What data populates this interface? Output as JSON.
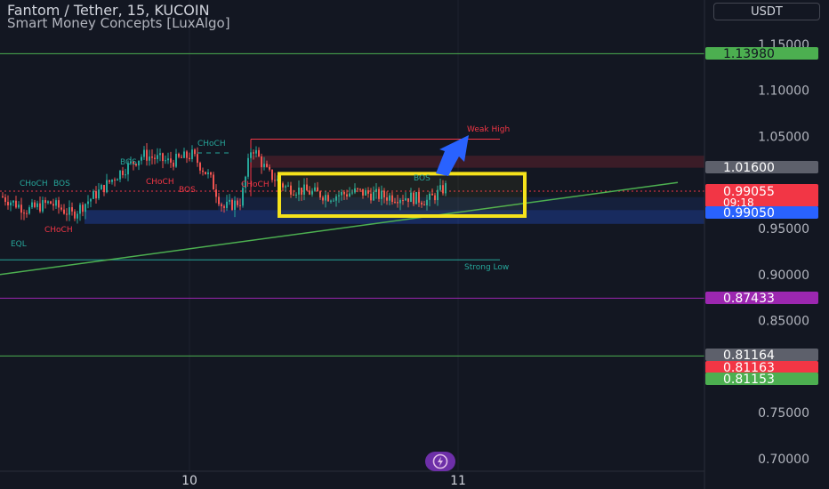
{
  "header": {
    "symbol": "Fantom / Tether, 15, KUCOIN",
    "indicator": "Smart Money Concepts [LuxAlgo]",
    "currency": "USDT"
  },
  "colors": {
    "background": "#131722",
    "grid": "#1e222d",
    "bull": "#26a69a",
    "bear": "#ef5350",
    "highlight": "#f5e21b",
    "arrow": "#2962ff",
    "green_line": "#4caf50"
  },
  "chart_data": {
    "type": "candlestick",
    "ylim": [
      0.69,
      1.165
    ],
    "y_ticks": [
      "0.70000",
      "0.75000",
      "0.85000",
      "0.90000",
      "0.95000",
      "1.05000",
      "1.10000",
      "1.15000"
    ],
    "x_ticks": [
      "10",
      "11"
    ],
    "price_labels": [
      {
        "value": 1.1398,
        "text": "1.13980",
        "color": "#4caf50",
        "text_color": "#131722"
      },
      {
        "value": 1.016,
        "text": "1.01600",
        "color": "#5d606b",
        "text_color": "#ffffff"
      },
      {
        "value": 0.99055,
        "text": "0.99055",
        "countdown": "09:18",
        "color": "#f23645",
        "text_color": "#ffffff"
      },
      {
        "value": 0.9905,
        "text": "0.99050",
        "color": "#2962ff",
        "text_color": "#ffffff"
      },
      {
        "value": 0.87433,
        "text": "0.87433",
        "color": "#9c27b0",
        "text_color": "#ffffff"
      },
      {
        "value": 0.81164,
        "text": "0.81164",
        "color": "#5d606b",
        "text_color": "#ffffff"
      },
      {
        "value": 0.81163,
        "text": "0.81163",
        "color": "#f23645",
        "text_color": "#ffffff"
      },
      {
        "value": 0.81153,
        "text": "0.81153",
        "color": "#4caf50",
        "text_color": "#ffffff"
      }
    ],
    "horizontal_lines": [
      {
        "value": 1.1398,
        "color": "#4caf50"
      },
      {
        "value": 0.87433,
        "color": "#9c27b0"
      },
      {
        "value": 0.81164,
        "color": "#4caf50"
      }
    ],
    "annotations": [
      {
        "text": "Weak High",
        "color": "#f23645"
      },
      {
        "text": "Strong Low",
        "color": "#26a69a"
      },
      {
        "text": "CHoCH",
        "color": "#26a69a"
      },
      {
        "text": "BOS",
        "color": "#26a69a"
      },
      {
        "text": "CHoCH",
        "color": "#f23645"
      },
      {
        "text": "BOS",
        "color": "#f23645"
      },
      {
        "text": "CHoCH",
        "color": "#f23645"
      },
      {
        "text": "BOS",
        "color": "#26a69a"
      },
      {
        "text": "CHoCH",
        "color": "#26a69a"
      },
      {
        "text": "CHoCH",
        "color": "#f23645"
      },
      {
        "text": "EQL",
        "color": "#26a69a"
      },
      {
        "text": "BOS",
        "color": "#26a69a"
      }
    ]
  }
}
